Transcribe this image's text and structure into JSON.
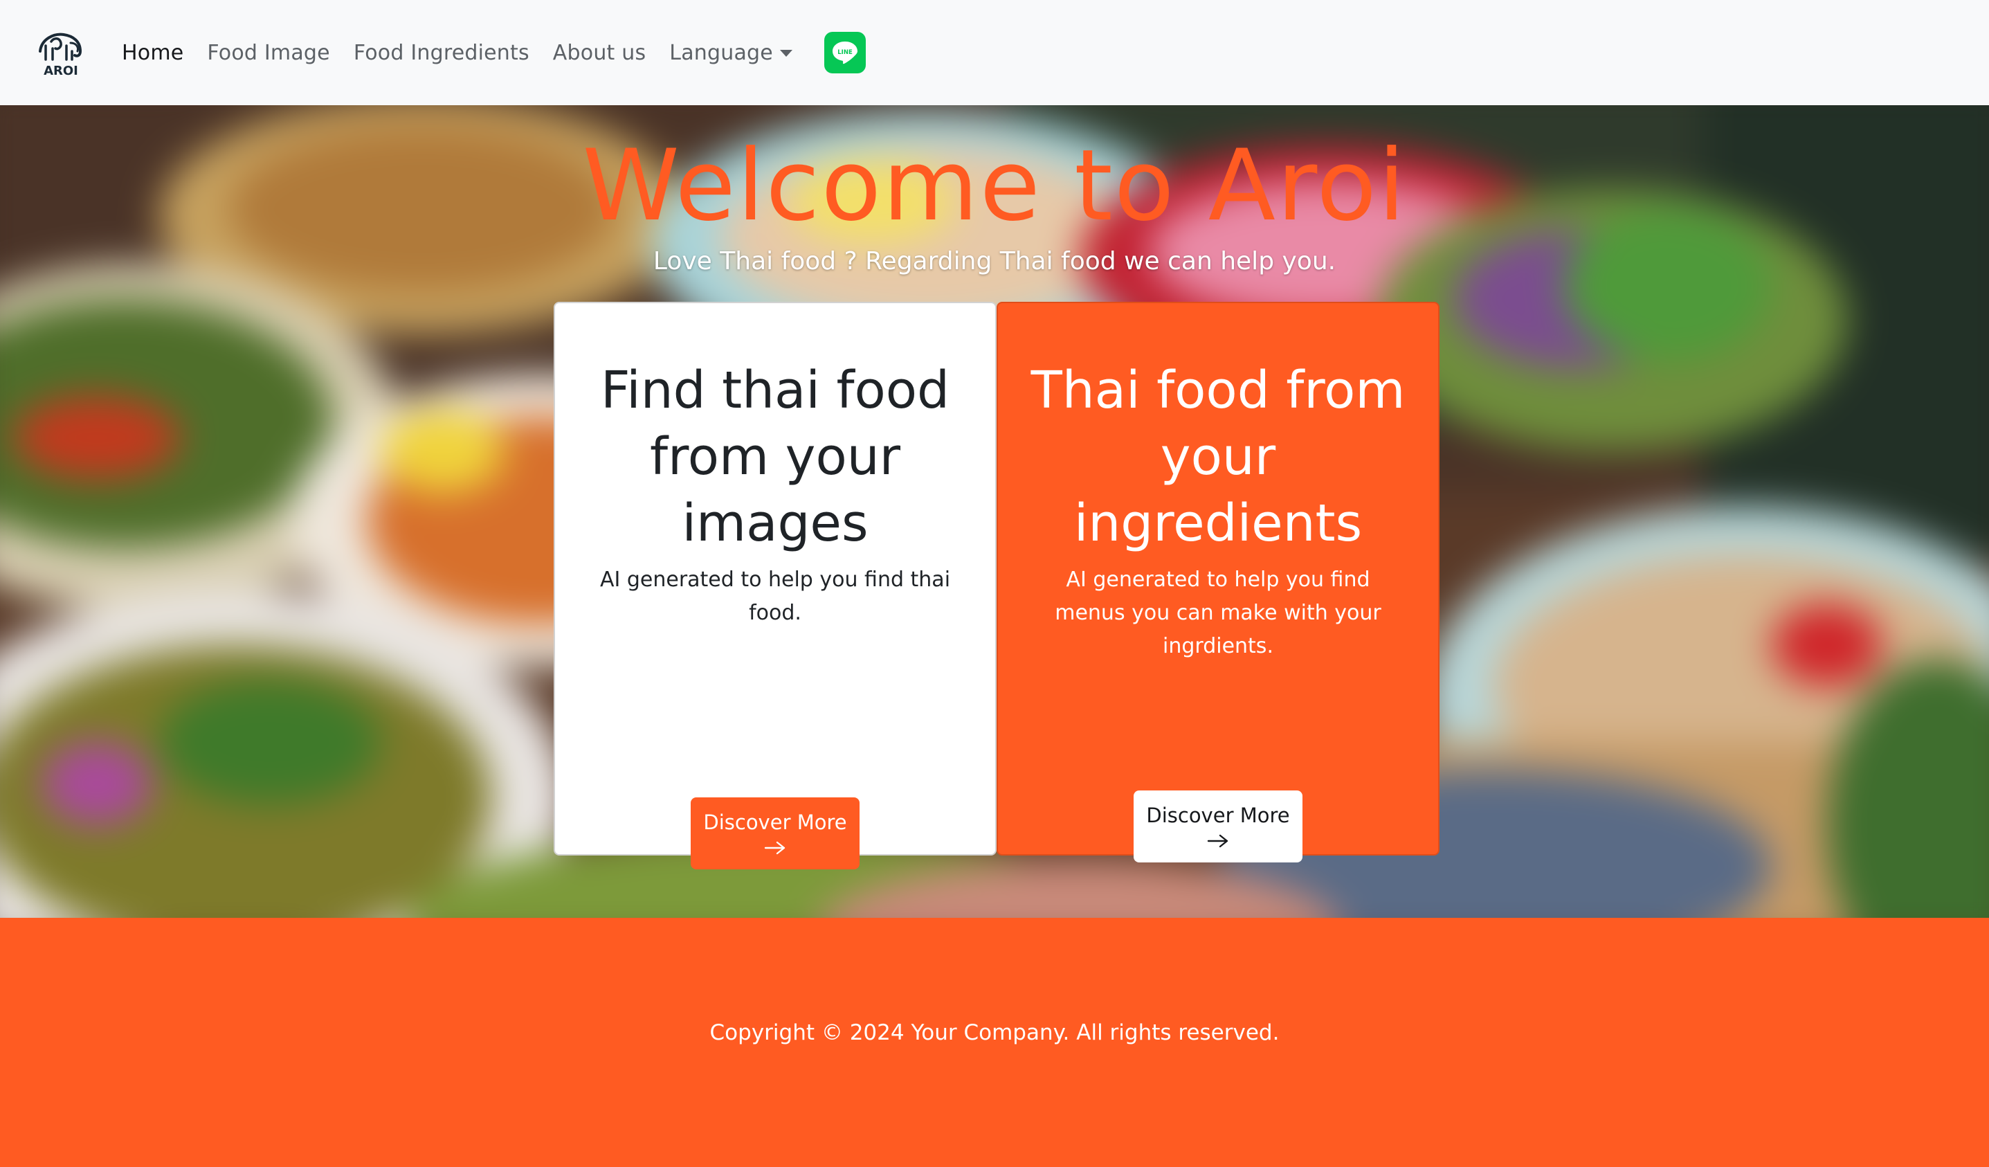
{
  "navbar": {
    "logo_text": "AROI",
    "links": [
      {
        "label": "Home",
        "active": true
      },
      {
        "label": "Food Image",
        "active": false
      },
      {
        "label": "Food Ingredients",
        "active": false
      },
      {
        "label": "About us",
        "active": false
      }
    ],
    "language_label": "Language",
    "line_icon_text": "LINE"
  },
  "hero": {
    "title": "Welcome to Aroi",
    "subtitle": "Love Thai food ? Regarding Thai food we can help you."
  },
  "cards": [
    {
      "title": "Find thai food from your images",
      "text": "AI generated to help you find thai food.",
      "button_label": "Discover More",
      "button_icon": "arrow-right-icon"
    },
    {
      "title": "Thai food from your ingredients",
      "text": "AI generated to help you find menus you can make with your ingrdients.",
      "button_label": "Discover More",
      "button_icon": "arrow-right-icon"
    }
  ],
  "footer": {
    "copyright": "Copyright © 2024 Your Company. All rights reserved."
  },
  "colors": {
    "accent": "#ff5b22",
    "navbar_bg": "#f8f9fa",
    "line_green": "#06c755",
    "text_dark": "#1f2327"
  }
}
